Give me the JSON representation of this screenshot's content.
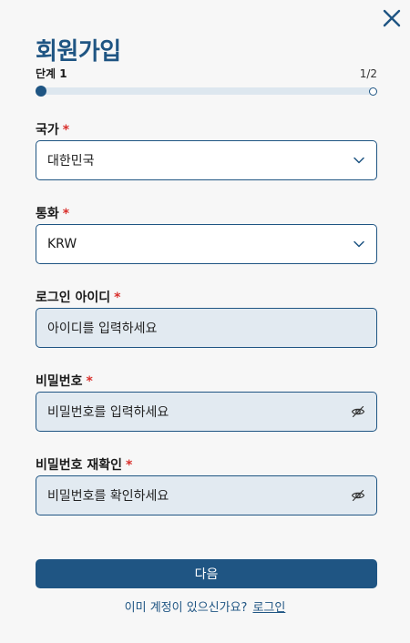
{
  "title": "회원가입",
  "step": {
    "label": "단계 1",
    "count": "1/2",
    "progress": 0
  },
  "fields": {
    "country": {
      "label": "국가",
      "required": "*",
      "value": "대한민국"
    },
    "currency": {
      "label": "통화",
      "required": "*",
      "value": "KRW"
    },
    "login_id": {
      "label": "로그인 아이디",
      "required": "*",
      "placeholder": "아이디를 입력하세요"
    },
    "password": {
      "label": "비밀번호",
      "required": "*",
      "placeholder": "비밀번호를 입력하세요"
    },
    "password_confirm": {
      "label": "비밀번호 재확인",
      "required": "*",
      "placeholder": "비밀번호를 확인하세요"
    }
  },
  "next_button": "다음",
  "footer": {
    "prompt": "이미 계정이 있으신가요?",
    "login_link": "로그인"
  },
  "icons": {
    "close": "close-icon",
    "chevron": "chevron-down-icon",
    "eye": "eye-off-icon"
  },
  "colors": {
    "primary": "#1f5583",
    "required": "#d9302c",
    "input_bg": "#e2eaf1",
    "page_bg": "#f7f7f7"
  }
}
